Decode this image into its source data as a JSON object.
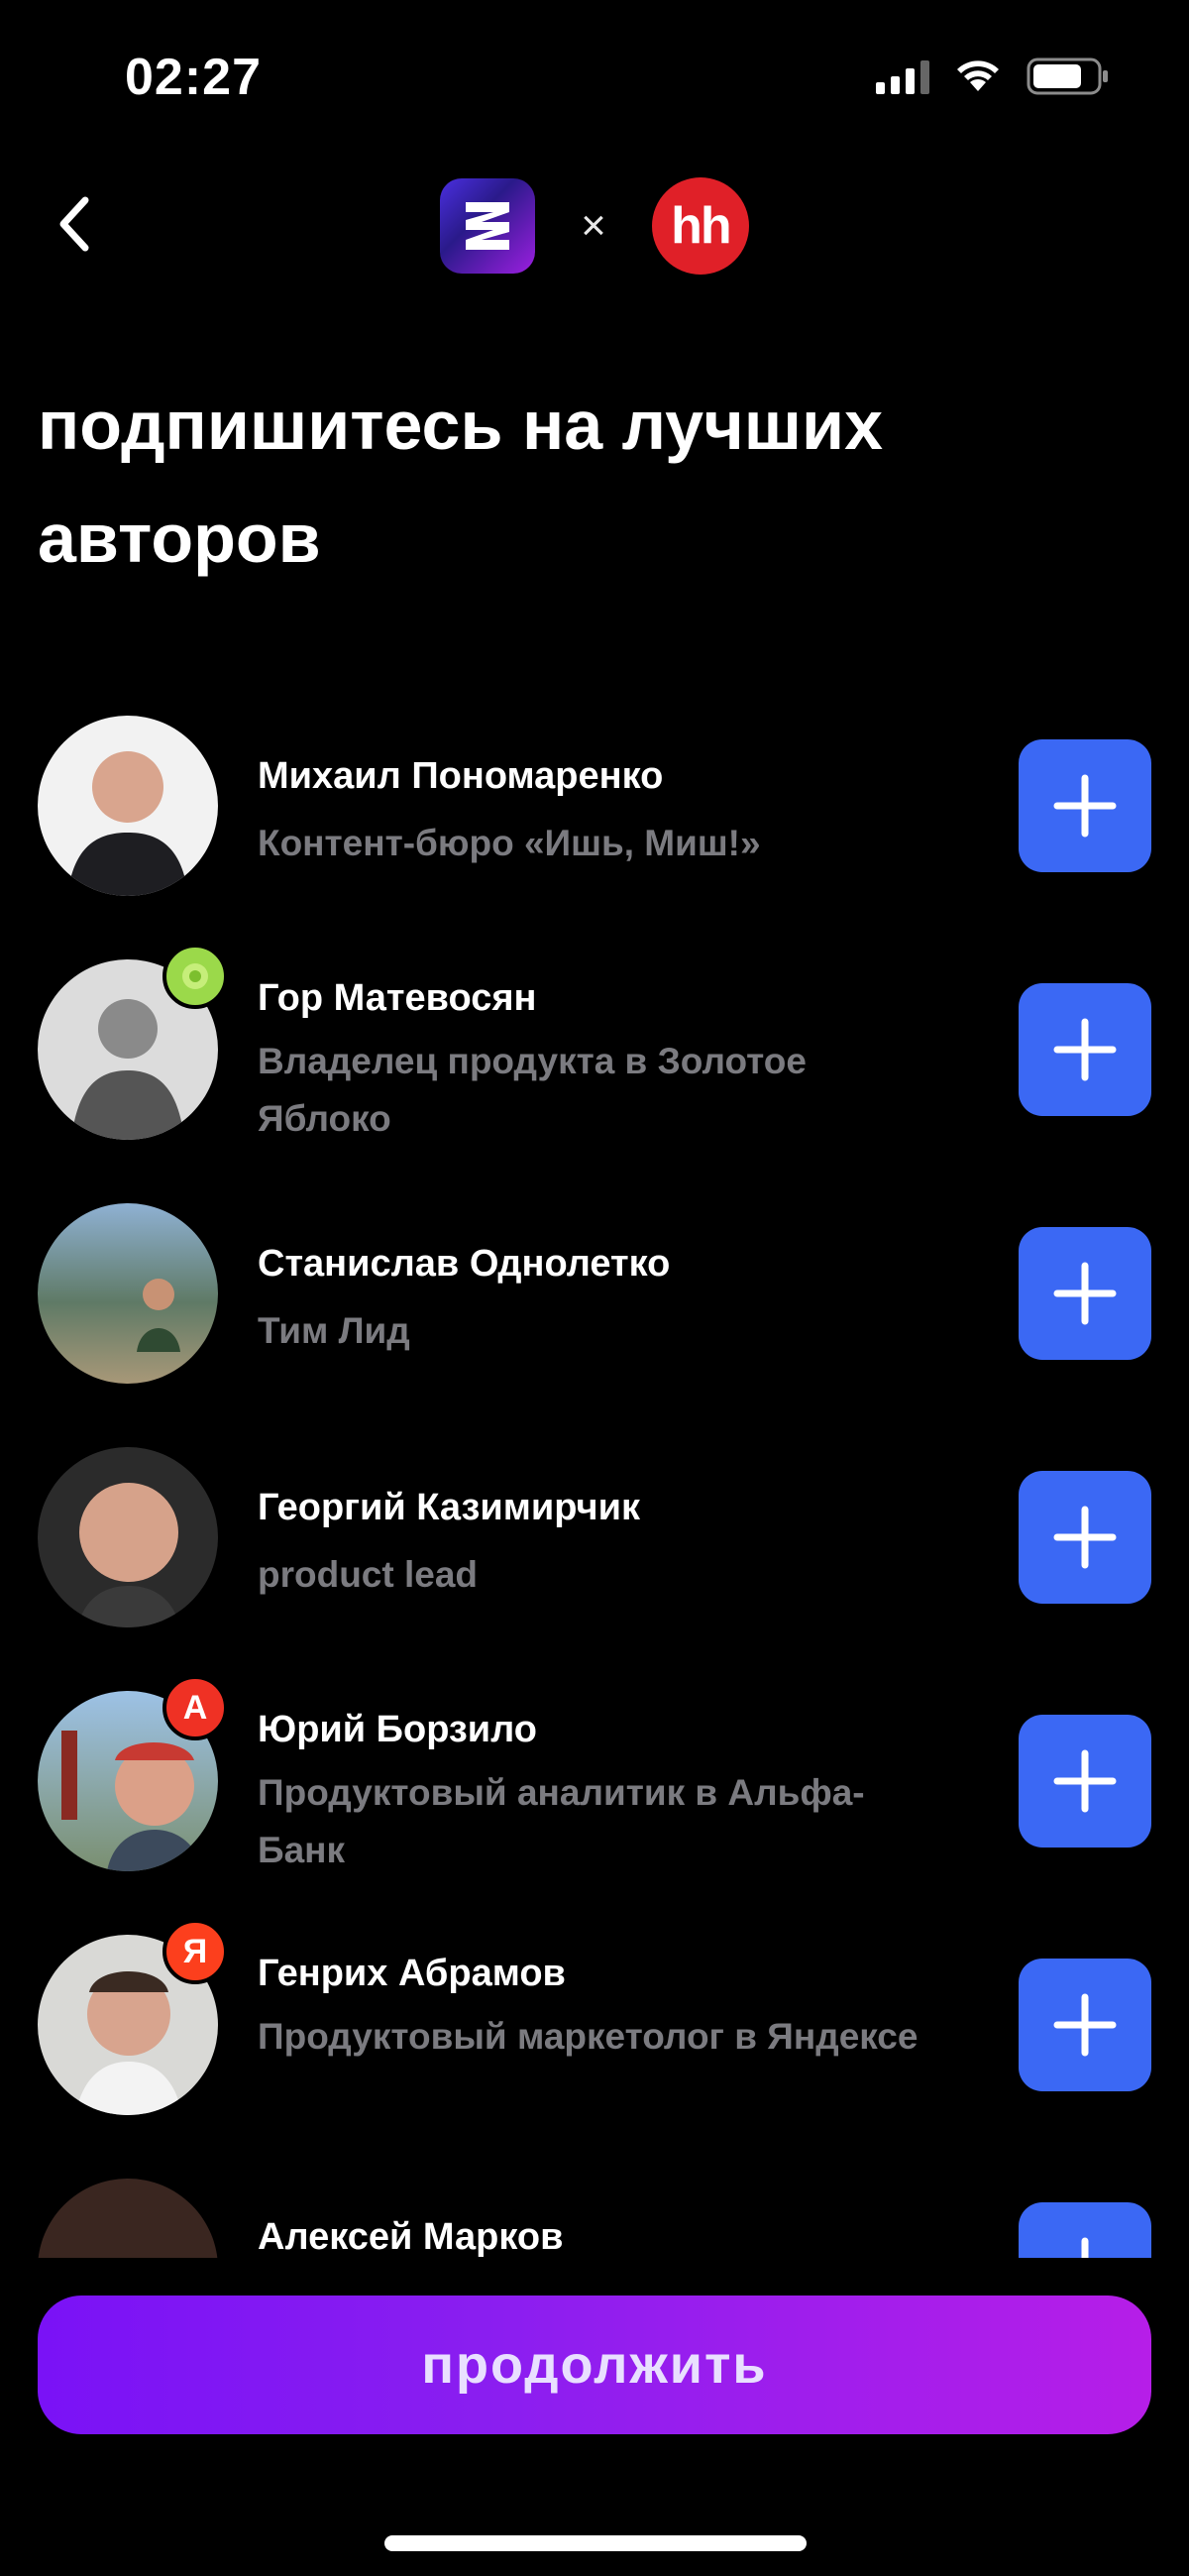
{
  "status_bar": {
    "time": "02:27"
  },
  "header": {
    "back_icon": "chevron-left-icon",
    "separator": "×",
    "hh_logo_text": "hh"
  },
  "title": "подпишитесь на лучших авторов",
  "authors": [
    {
      "name": "Михаил Пономаренко",
      "role": "Контент-бюро «Ишь, Миш!»"
    },
    {
      "name": "Гор Матевосян",
      "role": "Владелец продукта в Золотое Яблоко"
    },
    {
      "name": "Станислав Однолетко",
      "role": "Тим Лид"
    },
    {
      "name": "Георгий Казимирчик",
      "role": "product lead"
    },
    {
      "name": "Юрий Борзило",
      "role": "Продуктовый аналитик в Альфа-Банк",
      "badge": "А"
    },
    {
      "name": "Генрих Абрамов",
      "role": "Продуктовый маркетолог в Яндексе",
      "badge": "Я"
    },
    {
      "name": "Алексей Марков",
      "role": ""
    }
  ],
  "continue_label": "продолжить",
  "colors": {
    "accent_blue": "#3b68f4",
    "cta_gradient_start": "#7a12f6",
    "cta_gradient_end": "#b61ee8",
    "hh_red": "#e02028"
  }
}
